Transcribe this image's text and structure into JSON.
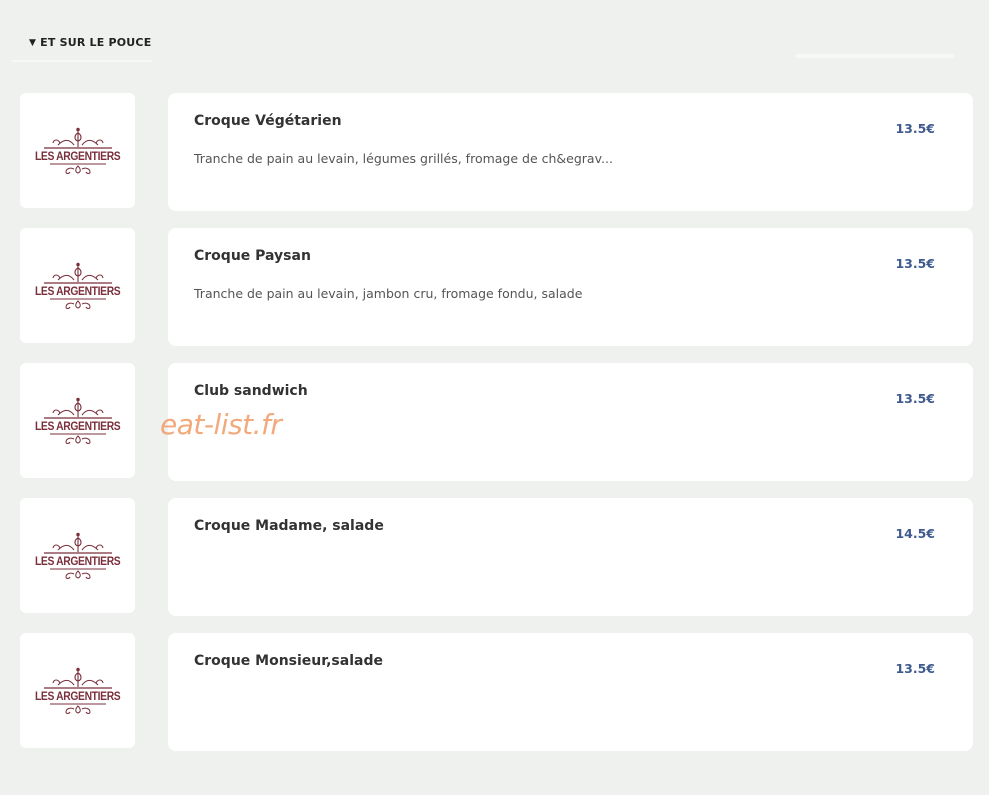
{
  "section": {
    "title": "ET SUR LE POUCE",
    "caret_icon": "caret-down-icon"
  },
  "brand": {
    "logo_text": "LES ARGENTIERS",
    "logo_color": "#7a2f3b"
  },
  "accent_color": "#3f5a8f",
  "watermark": "eat-list.fr",
  "items": [
    {
      "name": "Croque Végétarien",
      "description": "Tranche de pain au levain, légumes grillés, fromage de ch&egrav...",
      "price": "13.5€"
    },
    {
      "name": "Croque Paysan",
      "description": "Tranche de pain au levain, jambon cru, fromage fondu, salade",
      "price": "13.5€"
    },
    {
      "name": "Club sandwich",
      "description": "",
      "price": "13.5€"
    },
    {
      "name": "Croque Madame, salade",
      "description": "",
      "price": "14.5€"
    },
    {
      "name": "Croque Monsieur,salade",
      "description": "",
      "price": "13.5€"
    }
  ]
}
